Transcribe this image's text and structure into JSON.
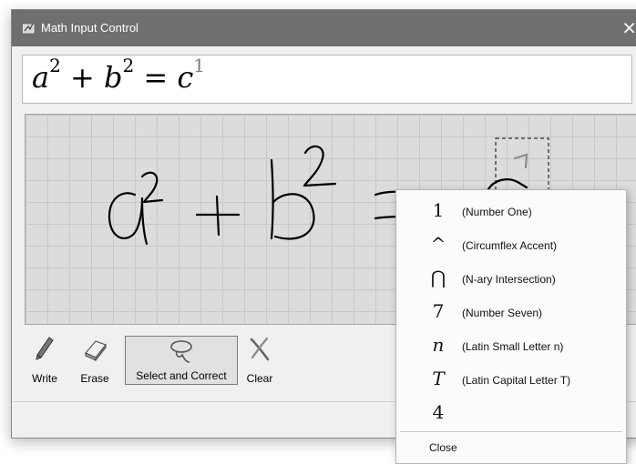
{
  "window": {
    "title": "Math Input Control",
    "close_glyph": "✕"
  },
  "formula": {
    "a": "a",
    "b": "b",
    "c": "c",
    "exp1": "2",
    "exp2": "2",
    "exp3": "1",
    "plus": "+",
    "equals": "="
  },
  "toolbar": {
    "write": "Write",
    "erase": "Erase",
    "select_correct": "Select and Correct",
    "clear": "Clear"
  },
  "menu": {
    "items": [
      {
        "symbol": "1",
        "description": "(Number One)"
      },
      {
        "symbol": "^",
        "description": "(Circumflex Accent)"
      },
      {
        "symbol": "⋂",
        "description": "(N-ary Intersection)"
      },
      {
        "symbol": "7",
        "description": "(Number Seven)"
      },
      {
        "symbol": "n",
        "description": "(Latin Small Letter n)"
      },
      {
        "symbol": "T",
        "description": "(Latin Capital Letter T)"
      },
      {
        "symbol": "4",
        "description": ""
      }
    ],
    "close": "Close"
  },
  "icons": {
    "app": "math-input-icon",
    "write": "pen-icon",
    "erase": "eraser-icon",
    "select": "lasso-icon",
    "clear": "clear-x-icon"
  }
}
